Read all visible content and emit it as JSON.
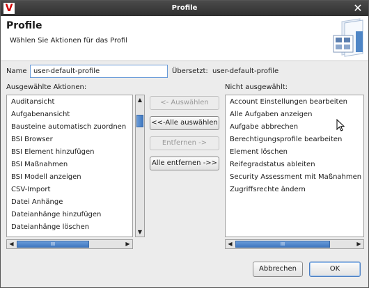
{
  "window": {
    "title": "Profile",
    "close_glyph": "✕",
    "logo_letter": "V"
  },
  "header": {
    "title": "Profile",
    "subtitle": "Wählen Sie Aktionen für das Profil"
  },
  "form": {
    "name_label": "Name",
    "name_value": "user-default-profile",
    "translated_label": "Übersetzt:",
    "translated_value": "user-default-profile"
  },
  "left_panel": {
    "label": "Ausgewählte Aktionen:",
    "items": [
      "Auditansicht",
      "Aufgabenansicht",
      "Bausteine automatisch zuordnen",
      "BSI Browser",
      "BSI Element hinzufügen",
      "BSI Maßnahmen",
      "BSI Modell anzeigen",
      "CSV-Import",
      "Datei Anhänge",
      "Dateianhänge hinzufügen",
      "Dateianhänge löschen"
    ]
  },
  "right_panel": {
    "label": "Nicht ausgewählt:",
    "items": [
      "Account Einstellungen bearbeiten",
      "Alle Aufgaben anzeigen",
      "Aufgabe abbrechen",
      "Berechtigungsprofile bearbeiten",
      "Element löschen",
      "Reifegradstatus ableiten",
      "Security Assessment mit Maßnahmen hi",
      "Zugriffsrechte ändern"
    ]
  },
  "transfer_buttons": {
    "select": "<- Auswählen",
    "select_all": "<<-Alle auswählen",
    "remove": "Entfernen ->",
    "remove_all": "Alle entfernen ->>"
  },
  "footer": {
    "cancel": "Abbrechen",
    "ok": "OK"
  },
  "icons": {
    "up": "▲",
    "down": "▼",
    "left": "◀",
    "right": "▶",
    "grip": "III"
  },
  "colors": {
    "accent": "#4b7fc4",
    "titlebar": "#3a3a3a",
    "logo_red": "#d10000"
  }
}
